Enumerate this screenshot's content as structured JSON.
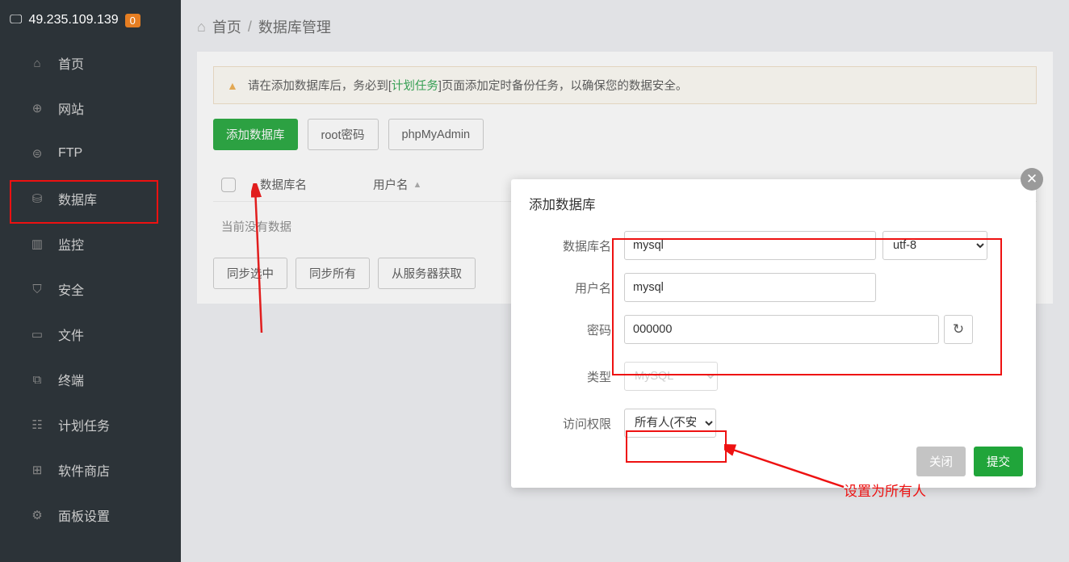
{
  "server": {
    "ip": "49.235.109.139",
    "badge": "0"
  },
  "sidebar": {
    "items": [
      {
        "label": "首页",
        "icon": "⌂"
      },
      {
        "label": "网站",
        "icon": "⊕"
      },
      {
        "label": "FTP",
        "icon": "⊜"
      },
      {
        "label": "数据库",
        "icon": "⛁"
      },
      {
        "label": "监控",
        "icon": "▥"
      },
      {
        "label": "安全",
        "icon": "⛉"
      },
      {
        "label": "文件",
        "icon": "▭"
      },
      {
        "label": "终端",
        "icon": "⧉"
      },
      {
        "label": "计划任务",
        "icon": "☷"
      },
      {
        "label": "软件商店",
        "icon": "⊞"
      },
      {
        "label": "面板设置",
        "icon": "⚙"
      }
    ]
  },
  "breadcrumb": {
    "home": "首页",
    "current": "数据库管理"
  },
  "alert": {
    "prefix": "请在添加数据库后，务必到[",
    "link": "计划任务",
    "suffix": "]页面添加定时备份任务，以确保您的数据安全。"
  },
  "actions": {
    "add": "添加数据库",
    "root": "root密码",
    "pma": "phpMyAdmin"
  },
  "table": {
    "col1": "数据库名",
    "col2": "用户名",
    "empty": "当前没有数据"
  },
  "bottomActions": {
    "sync_sel": "同步选中",
    "sync_all": "同步所有",
    "fetch": "从服务器获取"
  },
  "modal": {
    "title": "添加数据库",
    "labels": {
      "dbname": "数据库名",
      "username": "用户名",
      "password": "密码",
      "type": "类型",
      "access": "访问权限"
    },
    "values": {
      "dbname": "mysql",
      "username": "mysql",
      "password": "000000",
      "encoding": "utf-8",
      "type": "MySQL",
      "access": "所有人(不安全)"
    },
    "footer": {
      "close": "关闭",
      "submit": "提交"
    }
  },
  "annotation": {
    "text": "设置为所有人"
  }
}
